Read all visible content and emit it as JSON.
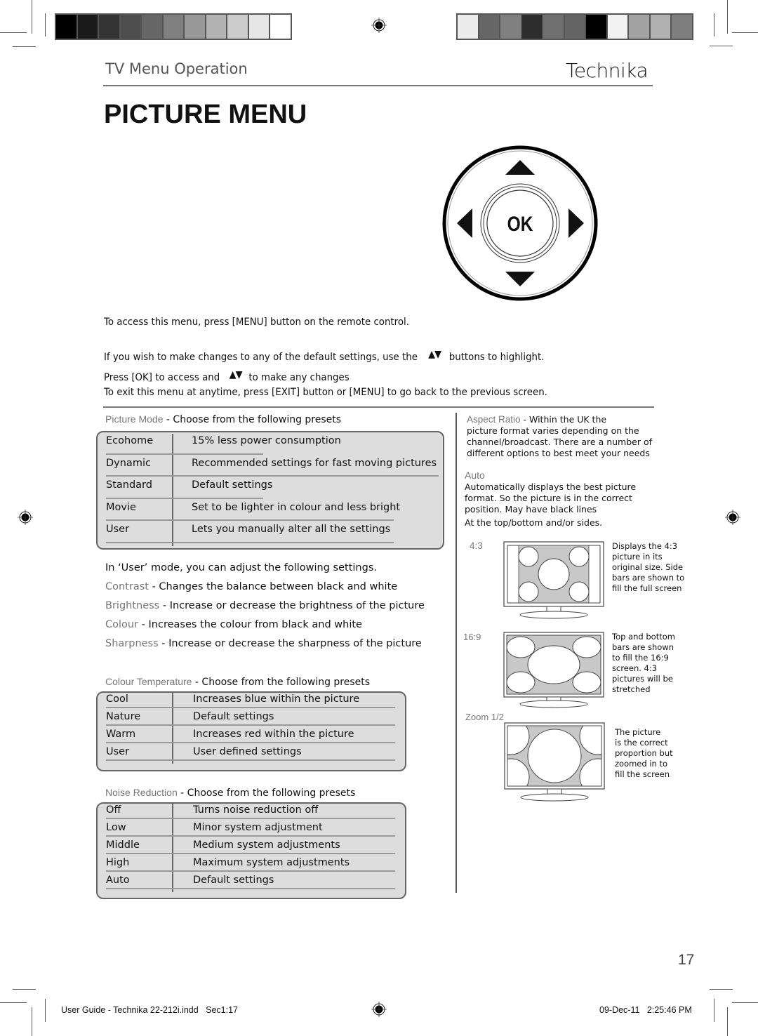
{
  "colorbars": {
    "left": [
      "#000000",
      "#1a1a1a",
      "#333333",
      "#4d4d4d",
      "#666666",
      "#808080",
      "#999999",
      "#b3b3b3",
      "#cccccc",
      "#e6e6e6",
      "#ffffff"
    ],
    "right": [
      "#ececec",
      "#666666",
      "#808080",
      "#2d2d2d",
      "#6f6f6f",
      "#646464",
      "#000000",
      "#f2f2f2",
      "#a2a2a2",
      "#b1b1b1",
      "#7f7f7f"
    ]
  },
  "header": {
    "section": "TV Menu Operation",
    "brand": "Technika"
  },
  "page_title": "PICTURE MENU",
  "remote": {
    "ok_label": "OK"
  },
  "intro": {
    "line1": "To access this menu, press [MENU] button on the remote control.",
    "line2_a": "If you wish to make changes to any of the default settings, use the",
    "line2_b": "buttons to highlight.",
    "line3_a": "Press [OK] to access and",
    "line3_b": "to make any changes",
    "line4": "To exit this menu at anytime, press [EXIT] button or [MENU] to go back to the previous screen.",
    "arrows": "▲▼"
  },
  "picture_mode": {
    "label": "Picture Mode",
    "desc": " - Choose from the following presets",
    "rows": [
      {
        "name": "Ecohome",
        "value": "15% less power consumption"
      },
      {
        "name": "Dynamic",
        "value": "Recommended settings for fast moving pictures"
      },
      {
        "name": "Standard",
        "value": "Default settings"
      },
      {
        "name": "Movie",
        "value": "Set to be lighter in colour and less bright"
      },
      {
        "name": "User",
        "value": "Lets you manually alter all the settings"
      }
    ]
  },
  "user_mode": {
    "intro": "In ‘User’ mode, you can adjust the following settings.",
    "settings": [
      {
        "label": "Contrast",
        "desc": " - Changes the balance between black and white"
      },
      {
        "label": "Brightness",
        "desc": " - Increase or decrease the brightness of the picture"
      },
      {
        "label": "Colour",
        "desc": " - Increases the colour from black and white"
      },
      {
        "label": "Sharpness",
        "desc": " - Increase or decrease the sharpness of the picture"
      }
    ]
  },
  "colour_temperature": {
    "label": "Colour Temperature",
    "desc": "  - Choose from the following presets",
    "rows": [
      {
        "name": "Cool",
        "value": "Increases blue within the picture"
      },
      {
        "name": "Nature",
        "value": "Default settings"
      },
      {
        "name": "Warm",
        "value": "Increases red within the picture"
      },
      {
        "name": "User",
        "value": " User defined settings"
      }
    ]
  },
  "noise_reduction": {
    "label": "Noise Reduction",
    "desc": " - Choose from the following presets",
    "rows": [
      {
        "name": "Off",
        "value": "Turns noise reduction off"
      },
      {
        "name": "Low",
        "value": "Minor system adjustment"
      },
      {
        "name": "Middle",
        "value": "Medium system adjustments"
      },
      {
        "name": "High",
        "value": "Maximum system adjustments"
      },
      {
        "name": "Auto",
        "value": "Default settings"
      }
    ]
  },
  "aspect_ratio": {
    "label": "Aspect Ratio",
    "desc_lines": [
      " - Within the UK the",
      "picture format varies depending on the",
      "channel/broadcast. There are a number of",
      "different options to best meet your needs"
    ],
    "auto_label": "Auto",
    "auto_lines": [
      "Automatically displays the best picture",
      "format. So the picture is in the correct",
      "position. May have black lines",
      "At the top/bottom and/or sides."
    ],
    "modes": [
      {
        "label": "4:3",
        "caption": [
          "Displays the 4:3",
          "picture in its",
          "original size. Side",
          "bars are shown to",
          "fill the full screen"
        ]
      },
      {
        "label": "16:9",
        "caption": [
          "Top and bottom",
          "bars are shown",
          "to fill the 16:9",
          "screen. 4:3",
          "pictures will be",
          "stretched"
        ]
      },
      {
        "label": "Zoom 1/2",
        "caption": [
          "The picture",
          "is the correct",
          "proportion but",
          "zoomed in to",
          "fill the screen"
        ]
      }
    ]
  },
  "page_number": "17",
  "footer": {
    "file": "User Guide - Technika 22-212i.indd   Sec1:17",
    "timestamp": "09-Dec-11   2:25:46 PM"
  }
}
